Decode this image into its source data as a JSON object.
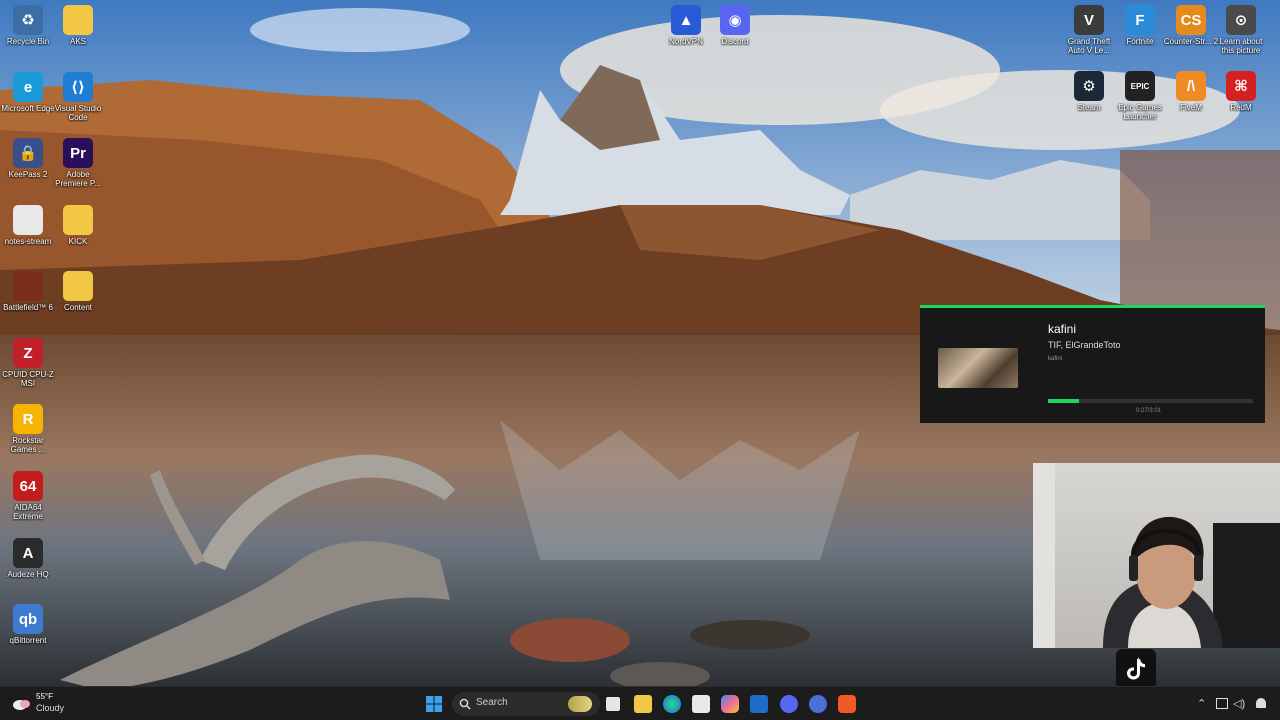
{
  "desktop_icons": [
    {
      "name": "recycle-bin-icon",
      "label": "Recycle Bin",
      "color": "#3b6ea5",
      "glyph": "♻"
    },
    {
      "name": "folder-icon",
      "label": "AKS",
      "color": "#f2c744",
      "glyph": ""
    },
    {
      "name": "microsoft-edge-icon",
      "label": "Microsoft Edge",
      "color": "#1a9bd7",
      "glyph": "e"
    },
    {
      "name": "visual-studio-code-icon",
      "label": "Visual Studio Code",
      "color": "#1f7ed3",
      "glyph": "⟨⟩"
    },
    {
      "name": "keepass-icon",
      "label": "KeePass 2",
      "color": "#3a4e8c",
      "glyph": "🔒"
    },
    {
      "name": "adobe-premiere-icon",
      "label": "Adobe Premiere P...",
      "color": "#2a0f5a",
      "glyph": "Pr"
    },
    {
      "name": "text-file-icon",
      "label": "notes-stream",
      "color": "#e8e8e8",
      "glyph": ""
    },
    {
      "name": "folder-icon",
      "label": "KICK",
      "color": "#f2c744",
      "glyph": ""
    },
    {
      "name": "battlefield-icon",
      "label": "Battlefield™ 6",
      "color": "#7a2d1a",
      "glyph": ""
    },
    {
      "name": "folder-icon",
      "label": "Content",
      "color": "#f2c744",
      "glyph": ""
    },
    {
      "name": "cpu-z-icon",
      "label": "CPUID CPU-Z MSI",
      "color": "#c0202a",
      "glyph": "Z"
    },
    {
      "name": "rockstar-games-icon",
      "label": "Rockstar Games ...",
      "color": "#f4b400",
      "glyph": "R"
    },
    {
      "name": "aida64-icon",
      "label": "AIDA64 Extreme",
      "color": "#c41c1c",
      "glyph": "64"
    },
    {
      "name": "audeze-icon",
      "label": "Audeze HQ",
      "color": "#2b2b2b",
      "glyph": "A"
    },
    {
      "name": "qbittorrent-icon",
      "label": "qBittorrent",
      "color": "#3c7bd0",
      "glyph": "qb"
    },
    {
      "name": "nordvpn-icon",
      "label": "NordVPN",
      "color": "#2a5bd7",
      "glyph": "▲"
    },
    {
      "name": "discord-icon",
      "label": "Discord",
      "color": "#5865f2",
      "glyph": "◉"
    },
    {
      "name": "gta-v-icon",
      "label": "Grand Theft Auto V Le...",
      "color": "#3c3c3c",
      "glyph": "V"
    },
    {
      "name": "fortnite-icon",
      "label": "Fortnite",
      "color": "#2a8bd8",
      "glyph": "F"
    },
    {
      "name": "counter-strike-icon",
      "label": "Counter-Str... 2",
      "color": "#e58b1d",
      "glyph": "CS"
    },
    {
      "name": "learn-about-picture-icon",
      "label": "Learn about this picture",
      "color": "#4a4a4a",
      "glyph": "⊙"
    },
    {
      "name": "steam-icon",
      "label": "Steam",
      "color": "#1b2838",
      "glyph": "⚙"
    },
    {
      "name": "epic-games-icon",
      "label": "Epic Games Launcher",
      "color": "#222222",
      "glyph": "EPIC"
    },
    {
      "name": "fivem-icon",
      "label": "FiveM",
      "color": "#f08a24",
      "glyph": "/\\"
    },
    {
      "name": "redm-icon",
      "label": "RedM",
      "color": "#d42020",
      "glyph": "⌘"
    }
  ],
  "media": {
    "title": "kafini",
    "artist": "TIF, ElGrandeToto",
    "album": "kafini",
    "time": "0:27/3:01",
    "progress": 0.15,
    "accent": "#1ed760"
  },
  "taskbar": {
    "weather_temp": "55°F",
    "weather_condition": "Cloudy",
    "search_label": "Search",
    "pinned": [
      "windows-start-icon",
      "chrome-dino-icon",
      "task-view-icon",
      "file-explorer-icon",
      "edge-icon",
      "store-icon",
      "copilot-icon",
      "outlook-icon",
      "discord-icon",
      "nordvpn-icon",
      "brave-icon"
    ]
  }
}
